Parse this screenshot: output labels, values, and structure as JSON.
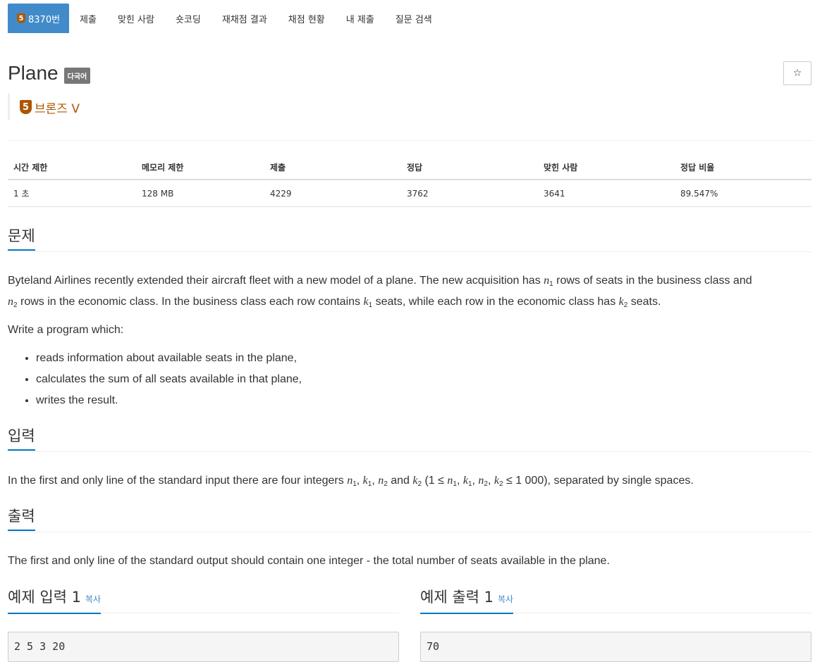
{
  "nav": {
    "problem_tab": "8370번",
    "tier_digit": "5",
    "items": [
      "제출",
      "맞힌 사람",
      "숏코딩",
      "재채점 결과",
      "채점 현황",
      "내 제출",
      "질문 검색"
    ]
  },
  "problem": {
    "title": "Plane",
    "lang_badge": "다국어",
    "star": "☆",
    "tier_digit": "5",
    "tier_name": "브론즈 V"
  },
  "info_table": {
    "headers": [
      "시간 제한",
      "메모리 제한",
      "제출",
      "정답",
      "맞힌 사람",
      "정답 비율"
    ],
    "values": [
      "1 초",
      "128 MB",
      "4229",
      "3762",
      "3641",
      "89.547%"
    ]
  },
  "sections": {
    "problem_heading": "문제",
    "input_heading": "입력",
    "output_heading": "출력",
    "sample_input_heading": "예제 입력 1",
    "sample_output_heading": "예제 출력 1",
    "copy_label": "복사"
  },
  "statement": {
    "p1_a": "Byteland Airlines recently extended their aircraft fleet with a new model of a plane. The new acquisition has ",
    "p1_b": " rows of seats in the business class and",
    "p1_c": " rows in the economic class. In the business class each row contains ",
    "p1_d": " seats, while each row in the economic class has ",
    "p1_e": " seats.",
    "p2": "Write a program which:",
    "bullets": [
      "reads information about available seats in the plane,",
      "calculates the sum of all seats available in that plane,",
      "writes the result."
    ]
  },
  "input_text": {
    "a": "In the first and only line of the standard input there are four integers ",
    "b": " and ",
    "c": " (1 ≤ ",
    "d": " ≤ 1 000), separated by single spaces."
  },
  "output_text": "The first and only line of the standard output should contain one integer - the total number of seats available in the plane.",
  "samples": {
    "input": "2 5 3 20",
    "output": "70"
  }
}
